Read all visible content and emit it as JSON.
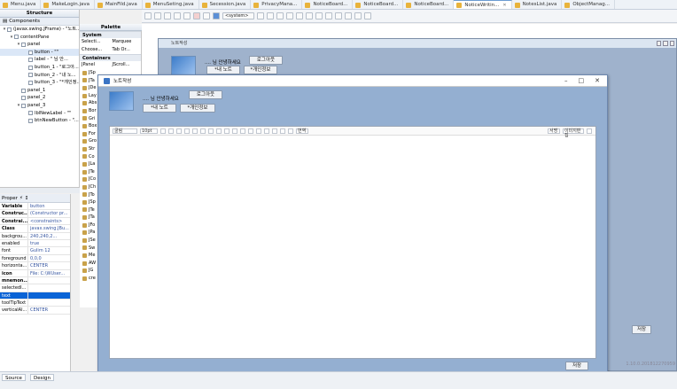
{
  "tabs": [
    "Menu.java",
    "MakeLogin.java",
    "MainFild.java",
    "MenuSeting.java",
    "Secession.java",
    "PrivacyMana...",
    "NoticeBoard...",
    "NoticeBoard...",
    "NoticeBoard...",
    "NoticeWritin...",
    "NotesList.java",
    "ObjectManag..."
  ],
  "structure": {
    "title": "Structure",
    "components_label": "Components",
    "tree": [
      {
        "label": "(javax.swing.JFrame) - \"노트...",
        "indent": 0,
        "arrow": "▾"
      },
      {
        "label": "contentPane",
        "indent": 1,
        "arrow": "▾"
      },
      {
        "label": "panel",
        "indent": 2,
        "arrow": "▾"
      },
      {
        "label": "button - \"\"",
        "indent": 3,
        "arrow": "",
        "sel": true
      },
      {
        "label": "label - \" 님 안...",
        "indent": 3,
        "arrow": ""
      },
      {
        "label": "button_1 - \"로그아...",
        "indent": 3,
        "arrow": ""
      },
      {
        "label": "button_2 - \"내 노...",
        "indent": 3,
        "arrow": ""
      },
      {
        "label": "button_3 - \"*개인정...",
        "indent": 3,
        "arrow": ""
      },
      {
        "label": "panel_1",
        "indent": 2,
        "arrow": ""
      },
      {
        "label": "panel_2",
        "indent": 2,
        "arrow": ""
      },
      {
        "label": "panel_3",
        "indent": 2,
        "arrow": "▾"
      },
      {
        "label": "lblNewLabel - \"\"",
        "indent": 3,
        "arrow": ""
      },
      {
        "label": "btnNewButton - \"...",
        "indent": 3,
        "arrow": ""
      }
    ]
  },
  "palette": {
    "title": "Palette",
    "system": "System",
    "selection": "Selecti...",
    "marquee": "Marquee",
    "choose": "Choose...",
    "taborder": "Tab Or...",
    "containers": "Containers",
    "jpanel": "JPanel",
    "jscroll": "JScroll...",
    "items": [
      "JSp",
      "JTa",
      "JDe",
      "Lay",
      "Abs",
      "Bor",
      "Gri",
      "Box",
      "For",
      "Gro",
      "Str",
      "Co",
      "JLa",
      "JTe",
      "JCo",
      "JCh",
      "JTo",
      "JSp",
      "JTe",
      "JTa",
      "JFo",
      "JPa",
      "JSe",
      "Sw",
      "Me",
      "AW",
      "JG",
      "cre"
    ]
  },
  "props": {
    "title": "Proper",
    "rows": [
      {
        "k": "Variable",
        "v": "button",
        "bold": true
      },
      {
        "k": "Construc...",
        "v": "(Constructor pr...",
        "bold": true
      },
      {
        "k": "Constrai...",
        "v": "<constraints>",
        "bold": true
      },
      {
        "k": "Class",
        "v": "javax.swing.JBu...",
        "bold": true
      },
      {
        "k": "backgrou...",
        "v": "240,240,2...",
        "bold": false
      },
      {
        "k": "enabled",
        "v": "true",
        "bold": false
      },
      {
        "k": "font",
        "v": "Gulim 12",
        "bold": false
      },
      {
        "k": "foreground",
        "v": "0,0,0",
        "bold": false
      },
      {
        "k": "horizonta...",
        "v": "CENTER",
        "bold": false
      },
      {
        "k": "icon",
        "v": "File: C:\\WUser...",
        "bold": true
      },
      {
        "k": "mnemon...",
        "v": "",
        "bold": true
      },
      {
        "k": "selectedI...",
        "v": "",
        "bold": false
      },
      {
        "k": "text",
        "v": "",
        "bold": false,
        "hl": true
      },
      {
        "k": "toolTipText",
        "v": "",
        "bold": false
      },
      {
        "k": "verticalAl...",
        "v": "CENTER",
        "bold": false
      }
    ]
  },
  "toolbar": {
    "system_select": "<system>"
  },
  "design": {
    "frame_title": "노트작성",
    "greeting": ".... 님  안녕하세요",
    "logout": "로그아웃",
    "my_notes": "*내 노트",
    "privacy": "*개인정보",
    "save": "저장"
  },
  "window": {
    "title": "노트작성",
    "greeting": ".... 님  안녕하세요",
    "logout": "로그아웃",
    "my_notes": "*내 노트",
    "privacy": "*개인정보",
    "font": "굴림",
    "size": "10pt",
    "save": "저장",
    "translate": "번역",
    "style": "서명",
    "image": "이미지편집"
  },
  "bottom": {
    "source": "Source",
    "design": "Design",
    "version": "1.10.0.201812270959"
  }
}
